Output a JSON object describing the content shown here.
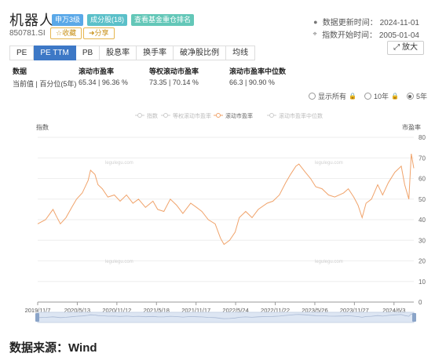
{
  "header": {
    "title": "机器人",
    "code": "850781.SI",
    "tags": [
      "申万3级",
      "成分股(18)",
      "查看基金重仓排名"
    ],
    "favorite_label": "☆收藏",
    "share_label": "➜分享",
    "update_time": "数据更新时间： 2024-11-01",
    "index_start": "指数开始时间： 2005-01-04",
    "clock_icon": "clock-icon",
    "pin_icon": "pin-icon"
  },
  "tabs": [
    "PE",
    "PE TTM",
    "PB",
    "股息率",
    "换手率",
    "破净股比例",
    "均线"
  ],
  "active_tab": "PE TTM",
  "expand_label": "放大",
  "stats": {
    "col1": {
      "header": "数据",
      "value": "当前值 | 百分位(5年)"
    },
    "col2": {
      "header": "滚动市盈率",
      "value": "65.34 | 96.36 %"
    },
    "col3": {
      "header": "等权滚动市盈率",
      "value": "73.35 | 70.14 %"
    },
    "col4": {
      "header": "滚动市盈率中位数",
      "value": "66.3 | 90.90 %"
    }
  },
  "range_options": {
    "all": "显示所有",
    "ten": "10年",
    "five": "5年",
    "selected": "5年"
  },
  "footer": "数据来源：Wind",
  "chart_data": {
    "type": "line",
    "legend": [
      "指数",
      "等权滚动市盈率",
      "滚动市盈率",
      "滚动市盈率中位数"
    ],
    "active_series": "滚动市盈率",
    "left_axis_label": "指数",
    "right_axis_label": "市盈率",
    "watermark": "legulegu.com",
    "x_tick_labels": [
      "2019/11/7",
      "2020/5/13",
      "2020/11/12",
      "2021/5/18",
      "2021/11/17",
      "2022/5/24",
      "2022/11/22",
      "2023/5/26",
      "2023/11/27",
      "2024/6/3"
    ],
    "ylim": [
      0,
      80
    ],
    "y_ticks": [
      0,
      10,
      20,
      30,
      40,
      50,
      60,
      70,
      80
    ],
    "grid": true,
    "legend_position": "top-center",
    "line_color": "#f0a36b",
    "series": [
      {
        "name": "滚动市盈率",
        "x": [
          "2019-11-07",
          "2019-12-15",
          "2020-01-20",
          "2020-02-04",
          "2020-02-25",
          "2020-03-23",
          "2020-04-20",
          "2020-05-13",
          "2020-06-10",
          "2020-07-08",
          "2020-07-20",
          "2020-08-10",
          "2020-08-25",
          "2020-09-15",
          "2020-10-12",
          "2020-11-12",
          "2020-12-10",
          "2021-01-10",
          "2021-02-10",
          "2021-03-09",
          "2021-04-12",
          "2021-05-18",
          "2021-06-10",
          "2021-07-10",
          "2021-08-10",
          "2021-09-10",
          "2021-10-10",
          "2021-11-17",
          "2021-12-15",
          "2022-01-10",
          "2022-02-10",
          "2022-03-15",
          "2022-04-10",
          "2022-04-27",
          "2022-05-24",
          "2022-06-20",
          "2022-07-10",
          "2022-08-10",
          "2022-09-10",
          "2022-10-10",
          "2022-11-22",
          "2022-12-20",
          "2023-01-20",
          "2023-02-20",
          "2023-03-15",
          "2023-04-10",
          "2023-04-25",
          "2023-05-26",
          "2023-06-20",
          "2023-07-15",
          "2023-08-15",
          "2023-09-15",
          "2023-10-15",
          "2023-11-27",
          "2023-12-20",
          "2024-01-15",
          "2024-02-05",
          "2024-02-25",
          "2024-03-15",
          "2024-04-10",
          "2024-05-10",
          "2024-06-03",
          "2024-07-01",
          "2024-08-01",
          "2024-09-01",
          "2024-09-18",
          "2024-10-08",
          "2024-10-20",
          "2024-11-01"
        ],
        "values": [
          38,
          40,
          45,
          42,
          38,
          41,
          46,
          50,
          53,
          59,
          64,
          62,
          57,
          55,
          51,
          52,
          49,
          52,
          48,
          50,
          46,
          49,
          45,
          44,
          50,
          47,
          43,
          48,
          46,
          44,
          40,
          38,
          31,
          28,
          30,
          34,
          41,
          44,
          41,
          45,
          48,
          49,
          52,
          58,
          62,
          66,
          67,
          63,
          60,
          56,
          55,
          52,
          51,
          53,
          55,
          51,
          47,
          41,
          48,
          50,
          57,
          52,
          58,
          63,
          66,
          57,
          50,
          72,
          65
        ]
      }
    ]
  }
}
